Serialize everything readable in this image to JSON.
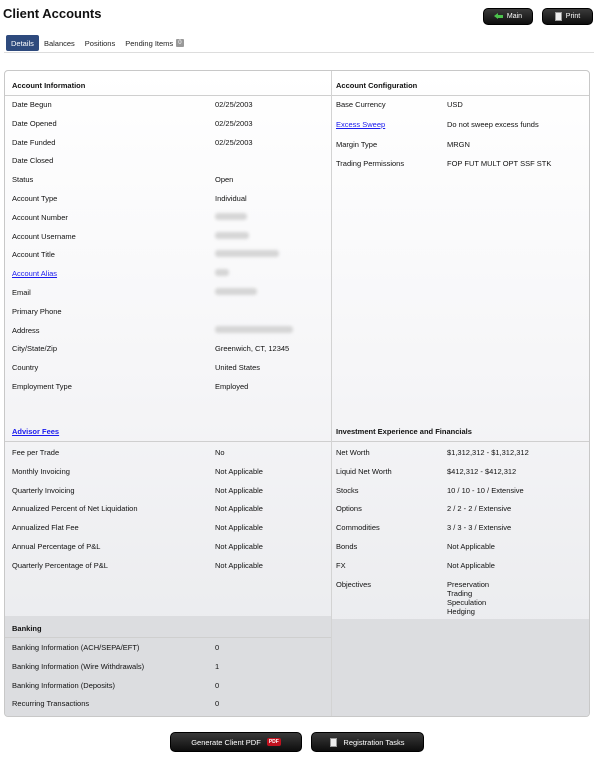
{
  "header": {
    "title": "Client Accounts",
    "main_label": "Main",
    "print_label": "Print"
  },
  "tabs": [
    {
      "label": "Details"
    },
    {
      "label": "Balances"
    },
    {
      "label": "Positions"
    },
    {
      "label": "Pending Items",
      "count": "0"
    }
  ],
  "account_info": {
    "title": "Account Information",
    "rows": [
      {
        "label": "Date Begun",
        "value": "02/25/2003"
      },
      {
        "label": "Date Opened",
        "value": "02/25/2003"
      },
      {
        "label": "Date Funded",
        "value": "02/25/2003"
      },
      {
        "label": "Date Closed",
        "value": ""
      },
      {
        "label": "Status",
        "value": "Open"
      },
      {
        "label": "Account Type",
        "value": "Individual"
      },
      {
        "label": "Account Number",
        "value": ""
      },
      {
        "label": "Account Username",
        "value": ""
      },
      {
        "label": "Account Title",
        "value": ""
      },
      {
        "label": "Account Alias",
        "value": ""
      },
      {
        "label": "Email",
        "value": ""
      },
      {
        "label": "Primary Phone",
        "value": ""
      },
      {
        "label": "Address",
        "value": ""
      },
      {
        "label": "City/State/Zip",
        "value": "Greenwich, CT, 12345"
      },
      {
        "label": "Country",
        "value": "United States"
      },
      {
        "label": "Employment Type",
        "value": "Employed"
      }
    ]
  },
  "account_config": {
    "title": "Account Configuration",
    "rows": [
      {
        "label": "Base Currency",
        "value": "USD"
      },
      {
        "label": "Excess Sweep",
        "value": "Do not sweep excess funds"
      },
      {
        "label": "Margin Type",
        "value": "MRGN"
      },
      {
        "label": "Trading Permissions",
        "value": "FOP FUT MULT OPT SSF STK"
      }
    ]
  },
  "advisor_fees": {
    "title": "Advisor Fees",
    "rows": [
      {
        "label": "Fee per Trade",
        "value": "No"
      },
      {
        "label": "Monthly Invoicing",
        "value": "Not Applicable"
      },
      {
        "label": "Quarterly Invoicing",
        "value": "Not Applicable"
      },
      {
        "label": "Annualized Percent of Net Liquidation",
        "value": "Not Applicable"
      },
      {
        "label": "Annualized Flat Fee",
        "value": "Not Applicable"
      },
      {
        "label": "Annual Percentage of P&L",
        "value": "Not Applicable"
      },
      {
        "label": "Quarterly Percentage of P&L",
        "value": "Not Applicable"
      }
    ]
  },
  "investment": {
    "title": "Investment Experience and Financials",
    "rows": [
      {
        "label": "Net Worth",
        "value": "$1,312,312 - $1,312,312"
      },
      {
        "label": "Liquid Net Worth",
        "value": "$412,312 - $412,312"
      },
      {
        "label": "Stocks",
        "value": "10 / 10 - 10 / Extensive"
      },
      {
        "label": "Options",
        "value": "2 / 2 - 2 / Extensive"
      },
      {
        "label": "Commodities",
        "value": "3 / 3 - 3 / Extensive"
      },
      {
        "label": "Bonds",
        "value": "Not Applicable"
      },
      {
        "label": "FX",
        "value": "Not Applicable"
      }
    ],
    "objectives_label": "Objectives",
    "objectives": [
      "Preservation",
      "Trading",
      "Speculation",
      "Hedging"
    ]
  },
  "banking": {
    "title": "Banking",
    "rows": [
      {
        "label": "Banking Information (ACH/SEPA/EFT)",
        "value": "0"
      },
      {
        "label": "Banking Information (Wire Withdrawals)",
        "value": "1"
      },
      {
        "label": "Banking Information (Deposits)",
        "value": "0"
      },
      {
        "label": "Recurring Transactions",
        "value": "0"
      }
    ]
  },
  "footer": {
    "pdf_label": "Generate Client PDF",
    "pdf_badge": "PDF",
    "reg_label": "Registration Tasks"
  }
}
